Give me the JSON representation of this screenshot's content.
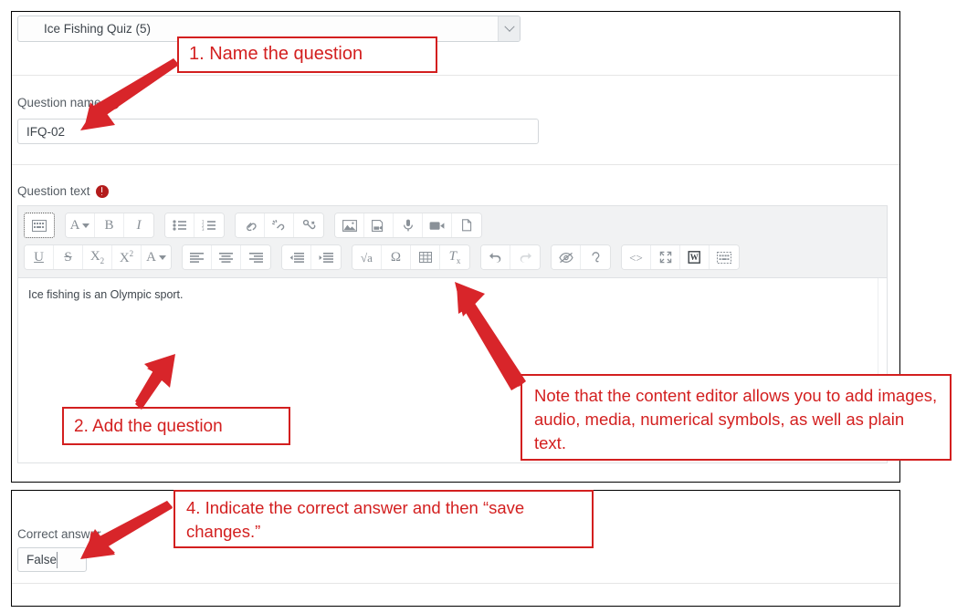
{
  "quiz_select": {
    "value": "Ice Fishing Quiz (5)",
    "arrow_icon": "chevron-down-icon"
  },
  "question_name": {
    "label": "Question name",
    "required_icon": "required-exclamation-icon",
    "value": "IFQ-02"
  },
  "question_text": {
    "label": "Question text",
    "required_icon": "required-exclamation-icon",
    "body": "Ice fishing is an Olympic sport."
  },
  "editor_toolbar": {
    "row1": [
      {
        "group": [
          {
            "name": "keyboard-icon",
            "glyph": ""
          }
        ]
      },
      {
        "group": [
          {
            "name": "font-color-icon",
            "glyph": "A"
          },
          {
            "name": "bold-icon",
            "glyph": "B"
          },
          {
            "name": "italic-icon",
            "glyph": "I"
          }
        ]
      },
      {
        "group": [
          {
            "name": "bullet-list-icon",
            "glyph": ""
          },
          {
            "name": "numbered-list-icon",
            "glyph": ""
          }
        ]
      },
      {
        "group": [
          {
            "name": "link-icon",
            "glyph": ""
          },
          {
            "name": "unlink-icon",
            "glyph": ""
          },
          {
            "name": "anchor-icon",
            "glyph": ""
          }
        ]
      },
      {
        "group": [
          {
            "name": "insert-image-icon",
            "glyph": ""
          },
          {
            "name": "insert-media-icon",
            "glyph": ""
          },
          {
            "name": "record-audio-icon",
            "glyph": ""
          },
          {
            "name": "record-video-icon",
            "glyph": ""
          },
          {
            "name": "manage-files-icon",
            "glyph": ""
          }
        ]
      }
    ],
    "row2": [
      {
        "group": [
          {
            "name": "underline-icon",
            "glyph": "U"
          },
          {
            "name": "strikethrough-icon",
            "glyph": "S"
          },
          {
            "name": "subscript-icon",
            "glyph": "X₂"
          },
          {
            "name": "superscript-icon",
            "glyph": "X²"
          },
          {
            "name": "text-align-dropdown-icon",
            "glyph": "A"
          }
        ]
      },
      {
        "group": [
          {
            "name": "align-left-icon",
            "glyph": ""
          },
          {
            "name": "align-center-icon",
            "glyph": ""
          },
          {
            "name": "align-right-icon",
            "glyph": ""
          }
        ]
      },
      {
        "group": [
          {
            "name": "outdent-icon",
            "glyph": ""
          },
          {
            "name": "indent-icon",
            "glyph": ""
          }
        ]
      },
      {
        "group": [
          {
            "name": "equation-editor-icon",
            "glyph": "√a"
          },
          {
            "name": "special-character-icon",
            "glyph": "Ω"
          },
          {
            "name": "insert-table-icon",
            "glyph": ""
          },
          {
            "name": "clear-formatting-icon",
            "glyph": "Tₓ"
          }
        ]
      },
      {
        "group": [
          {
            "name": "undo-icon",
            "glyph": ""
          },
          {
            "name": "redo-icon",
            "glyph": ""
          }
        ]
      },
      {
        "group": [
          {
            "name": "accessibility-checker-icon",
            "glyph": ""
          },
          {
            "name": "screenreader-helper-icon",
            "glyph": ""
          }
        ]
      },
      {
        "group": [
          {
            "name": "html-source-icon",
            "glyph": "<>"
          },
          {
            "name": "fullscreen-icon",
            "glyph": ""
          },
          {
            "name": "paste-from-word-icon",
            "glyph": "W"
          },
          {
            "name": "onscreen-keyboard-icon",
            "glyph": ""
          }
        ]
      }
    ]
  },
  "correct_answer": {
    "label": "Correct answer",
    "value": "False",
    "arrow_icon": "chevron-down-icon"
  },
  "annotations": {
    "step1": "1. Name the question",
    "step2": "2. Add the question",
    "note": "Note that the content editor allows you to add images, audio, media, numerical symbols, as well as plain text.",
    "step4": "4. Indicate the correct answer and then “save changes.”"
  },
  "colors": {
    "annotation_red": "#d31f1f",
    "arrow_red": "#d8252a",
    "required_red": "#b31b1b",
    "toolbar_bg": "#f1f2f3",
    "border_grey": "#dfe1e4"
  }
}
